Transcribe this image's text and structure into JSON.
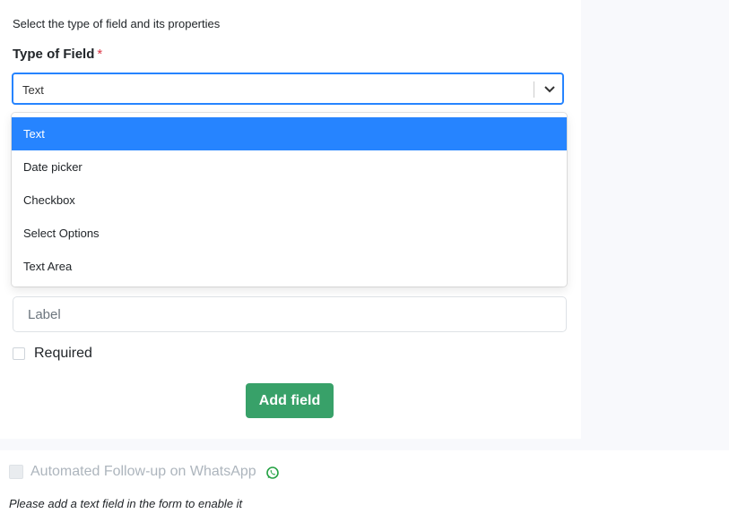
{
  "form": {
    "instructions": "Select the type of field and its properties",
    "type_label": "Type of Field",
    "required_marker": "*",
    "select": {
      "selected_value": "Text",
      "options": [
        "Text",
        "Date picker",
        "Checkbox",
        "Select Options",
        "Text Area"
      ],
      "selected_index": 0
    },
    "label_input": {
      "placeholder": "Label",
      "value": ""
    },
    "required_checkbox": {
      "label": "Required",
      "checked": false
    },
    "add_button_label": "Add field"
  },
  "whatsapp": {
    "label": "Automated Follow-up on WhatsApp",
    "checked": false,
    "disabled": true,
    "icon": "whatsapp-icon",
    "hint": "Please add a text field in the form to enable it"
  },
  "colors": {
    "accent_blue": "#2684ff",
    "button_green": "#38a169",
    "required_red": "#dc3545",
    "whatsapp_green": "#25a244"
  }
}
